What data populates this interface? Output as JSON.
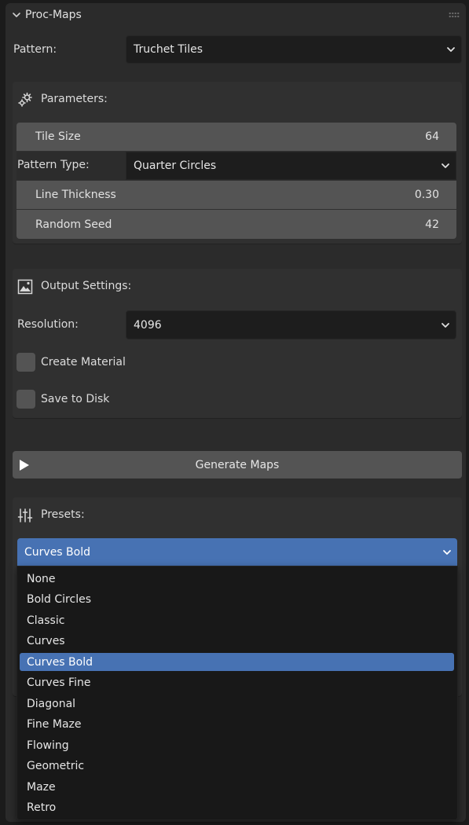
{
  "panel": {
    "title": "Proc-Maps",
    "pattern_label": "Pattern:",
    "pattern_value": "Truchet Tiles"
  },
  "parameters": {
    "title": "Parameters:",
    "tile_size_label": "Tile Size",
    "tile_size_value": "64",
    "pattern_type_label": "Pattern Type:",
    "pattern_type_value": "Quarter Circles",
    "line_thickness_label": "Line Thickness",
    "line_thickness_value": "0.30",
    "random_seed_label": "Random Seed",
    "random_seed_value": "42"
  },
  "output": {
    "title": "Output Settings:",
    "resolution_label": "Resolution:",
    "resolution_value": "4096",
    "create_material_label": "Create Material",
    "create_material_checked": false,
    "save_to_disk_label": "Save to Disk",
    "save_to_disk_checked": false
  },
  "generate": {
    "label": "Generate Maps"
  },
  "presets": {
    "title": "Presets:",
    "selected": "Curves Bold",
    "items": [
      "None",
      "Bold Circles",
      "Classic",
      "Curves",
      "Curves Bold",
      "Curves Fine",
      "Diagonal",
      "Fine Maze",
      "Flowing",
      "Geometric",
      "Maze",
      "Retro"
    ],
    "selected_index": 4
  },
  "colors": {
    "panel_bg": "#2b2b2b",
    "box_bg": "#303030",
    "field_bg": "#545454",
    "dropdown_bg": "#1d1d1d",
    "accent": "#4772b3",
    "menu_bg": "#181818"
  }
}
